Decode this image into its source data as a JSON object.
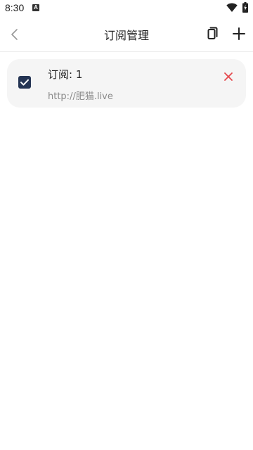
{
  "status_bar": {
    "time": "8:30",
    "notification_glyph": "A"
  },
  "app_bar": {
    "title": "订阅管理"
  },
  "subscriptions": [
    {
      "name": "订阅: 1",
      "url": "http://肥猫.live",
      "enabled": true
    }
  ],
  "colors": {
    "checkbox": "#253554",
    "delete": "#e5484d",
    "card_bg": "#f5f5f5"
  }
}
